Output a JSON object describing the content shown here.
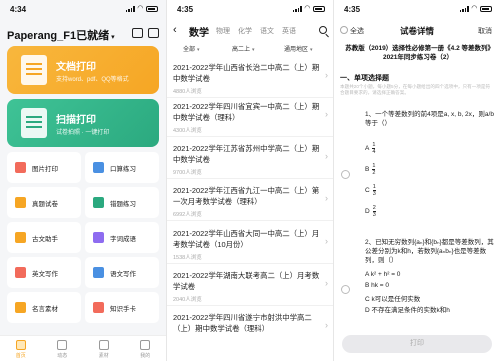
{
  "colors": {
    "orange": "#f6a624",
    "green": "#2ba97f",
    "text": "#222222",
    "muted": "#aaaaaa"
  },
  "phone1": {
    "status_time": "4:34",
    "title": "Paperang_F1已就绪",
    "header_icons": [
      "printer-settings-icon",
      "scan-icon"
    ],
    "card_doc": {
      "title": "文档打印",
      "subtitle": "支持word、pdf、QQ等格式"
    },
    "card_scan": {
      "title": "扫描打印",
      "subtitle": "试卷拍照 · 一键打印"
    },
    "grid": [
      {
        "label": "图片打印",
        "icon": "image-icon",
        "color": "#f26b5b"
      },
      {
        "label": "口算练习",
        "icon": "calculator-icon",
        "color": "#4a90e2"
      },
      {
        "label": "真题试卷",
        "icon": "exam-icon",
        "color": "#f6a624"
      },
      {
        "label": "错题练习",
        "icon": "mistake-book-icon",
        "color": "#2ba97f"
      },
      {
        "label": "古文助手",
        "icon": "classic-text-icon",
        "color": "#f6a624"
      },
      {
        "label": "字词成语",
        "icon": "word-icon",
        "color": "#8e6cf0"
      },
      {
        "label": "英文写作",
        "icon": "english-writing-icon",
        "color": "#f26b5b"
      },
      {
        "label": "语文写作",
        "icon": "chinese-writing-icon",
        "color": "#4a90e2"
      },
      {
        "label": "名言素材",
        "icon": "quote-icon",
        "color": "#f6a624"
      },
      {
        "label": "知识手卡",
        "icon": "knowledge-card-icon",
        "color": "#f26b5b"
      }
    ],
    "tabs": [
      {
        "label": "首页",
        "icon": "home-icon"
      },
      {
        "label": "动态",
        "icon": "feed-icon"
      },
      {
        "label": "素材",
        "icon": "material-icon"
      },
      {
        "label": "我的",
        "icon": "profile-icon"
      }
    ]
  },
  "phone2": {
    "status_time": "4:35",
    "subjects": [
      "数学",
      "物理",
      "化学",
      "语文",
      "英语"
    ],
    "filters": [
      "全部",
      "高二上",
      "通用地区"
    ],
    "rows": [
      {
        "title": "2021-2022学年山西省长治二中高二（上）期中数学试卷",
        "count": "4880人浏览"
      },
      {
        "title": "2021-2022学年四川省宜宾一中高二（上）期中数学试卷（理科）",
        "count": "4300人浏览"
      },
      {
        "title": "2021-2022学年江苏省苏州中学高二（上）期中数学试卷",
        "count": "9700人浏览"
      },
      {
        "title": "2021-2022学年江西省九江一中高二（上）第一次月考数学试卷（理科）",
        "count": "6992人浏览"
      },
      {
        "title": "2021-2022学年山西省大同一中高二（上）月考数学试卷（10月份）",
        "count": "1538人浏览"
      },
      {
        "title": "2021-2022学年湖南大联考高二（上）月考数学试卷",
        "count": "2040人浏览"
      },
      {
        "title": "2021-2022学年四川省遂宁市射洪中学高二（上）期中数学试卷（理科）",
        "count": ""
      }
    ]
  },
  "phone3": {
    "status_time": "4:35",
    "select_all": "全选",
    "title": "试卷详情",
    "cancel": "取消",
    "doc_title": "苏教版（2019）选择性必修第一册《4.2 等差数列》2021年同步练习卷（2）",
    "section": "一、单项选择题",
    "section_note": "本题共20个小题，每小题5分，在每小题给出的四个选项中，只有一项是符合题目要求的，请选择正确答案。",
    "q1": "1、一个等差数列的前4项是a, x, b, 2x，则a/b等于（）",
    "q1_options": [
      {
        "letter": "A",
        "num": "1",
        "den": "4"
      },
      {
        "letter": "B",
        "num": "1",
        "den": "2"
      },
      {
        "letter": "C",
        "num": "1",
        "den": "3"
      },
      {
        "letter": "D",
        "num": "2",
        "den": "3"
      }
    ],
    "q2": "2、已知无穷数列{aₙ}和{bₙ}都是等差数列，其公差分别为k和h，若数列{aₙbₙ}也是等差数列，则（）",
    "q2_options": [
      "A  k² + h² = 0",
      "B  hk = 0",
      "C  k可以是任何实数",
      "D  不存在满足条件的实数k和h"
    ],
    "print_button": "打印"
  }
}
